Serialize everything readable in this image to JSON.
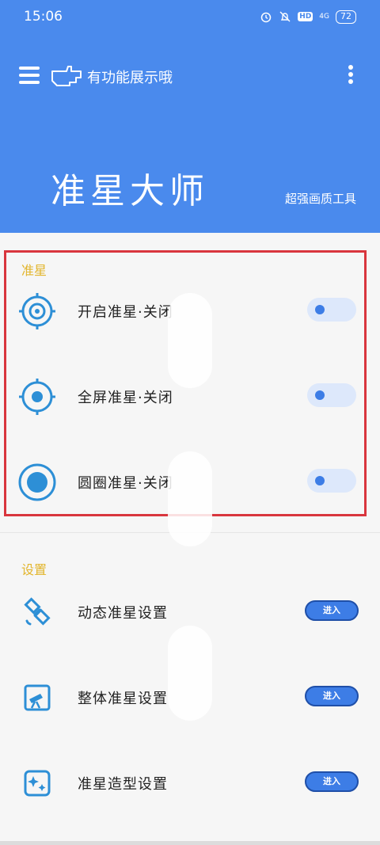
{
  "status_bar": {
    "time": "15:06",
    "hd": "HD",
    "signal": "4G",
    "battery": "72"
  },
  "app_bar": {
    "title": "有功能展示哦"
  },
  "hero": {
    "app_name": "准星大师",
    "subtitle": "超强画质工具"
  },
  "sections": {
    "crosshair": {
      "title": "准星",
      "items": [
        {
          "label": "开启准星·关闭",
          "icon": "crosshair-ring-icon",
          "toggle_on": false
        },
        {
          "label": "全屏准星·关闭",
          "icon": "crosshair-dot-icon",
          "toggle_on": false
        },
        {
          "label": "圆圈准星·关闭",
          "icon": "circle-dot-icon",
          "toggle_on": false
        }
      ]
    },
    "settings": {
      "title": "设置",
      "items": [
        {
          "label": "动态准星设置",
          "icon": "satellite-icon",
          "button": "进入"
        },
        {
          "label": "整体准星设置",
          "icon": "telescope-icon",
          "button": "进入"
        },
        {
          "label": "准星造型设置",
          "icon": "sparkle-icon",
          "button": "进入"
        }
      ]
    }
  },
  "colors": {
    "header_bg": "#4a8aed",
    "accent": "#3d7de6",
    "section_title": "#e2b52c",
    "highlight_border": "#d9363e"
  }
}
